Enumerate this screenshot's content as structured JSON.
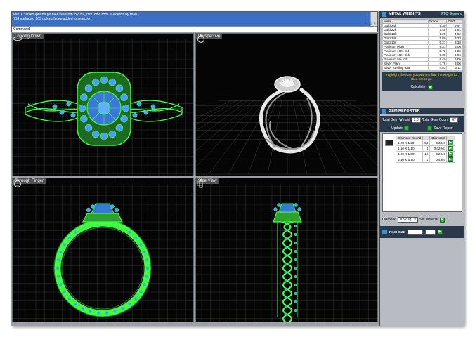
{
  "command": {
    "log_lines": [
      "File \"C:\\Users\\pferna.pe\\n4\\Kssassoft\\352059_rsfx1882.3dm\" successfully read",
      "714 surfaces, 165 polysurfaces added to selection"
    ],
    "prompt": "Command:"
  },
  "viewports": {
    "top_left": "Looking Down",
    "top_right": "Perspective",
    "bottom_left": "Through Finger",
    "bottom_right": "Side View"
  },
  "metal_weights": {
    "title": "METAL WEIGHTS",
    "tab_label": "FTO General",
    "columns": [
      "Metal",
      "Grams",
      "DWT"
    ],
    "rows": [
      [
        "Gold 24k",
        "9.30",
        "5.97"
      ],
      [
        "Gold 22k",
        "7.48",
        "4.81"
      ],
      [
        "Gold 18k",
        "6.25",
        "4.02"
      ],
      [
        "Gold 14k",
        "5.80",
        "3.73"
      ],
      [
        "Gold 10k",
        "5.27",
        "3.38"
      ],
      [
        "Platinum Plain",
        "9.37",
        "6.06"
      ],
      [
        "Platinum 10% Irid",
        "9.72",
        "6.25"
      ],
      [
        "Platinum 10% Iridi",
        "9.28",
        "5.96"
      ],
      [
        "Platinum 5% Irid",
        "9.40",
        "6.05"
      ],
      [
        "Silver Plain",
        "4.76",
        "3.06"
      ],
      [
        "Silver Sterling 925",
        "4.83",
        "3.11"
      ]
    ],
    "hint": "Highlight the item you want to find the weight for then press go.",
    "calculate_label": "Calculate",
    "go_label": "▶"
  },
  "gem_reporter": {
    "title": "GEM REPORTER",
    "total_weight_label": "Total Gem Weight",
    "total_weight_value": "1.0",
    "total_count_label": "Total Gem Count",
    "total_count_value": "67",
    "update_label": "Update",
    "save_label": "Save Report",
    "table_headers": [
      "Diamond Round",
      "",
      "Diamond",
      ""
    ],
    "gems": [
      {
        "size": "1.20 X 1.20",
        "count": "50",
        "weight": "0.33ct"
      },
      {
        "size": "1.10 X 1.10",
        "count": "4",
        "weight": "0.020ct"
      },
      {
        "size": "1.80 X 1.80",
        "count": "12",
        "weight": "0.20ct"
      },
      {
        "size": "5.10 X 5.10",
        "count": "1",
        "weight": "0.48ct"
      }
    ],
    "stone_label": "Diamond",
    "stone_value": "0.52 sg",
    "set_material_label": "Set Material"
  },
  "ring_size": {
    "label": "RING SIZE",
    "country": "USA",
    "size": "7"
  },
  "colors": {
    "wireframe": "#3dff40",
    "gem_blue": "#4aa0ff",
    "viewport_bg": "#050505",
    "grid": "#3a3a3a",
    "panel_dark": "#2b3a4a"
  }
}
